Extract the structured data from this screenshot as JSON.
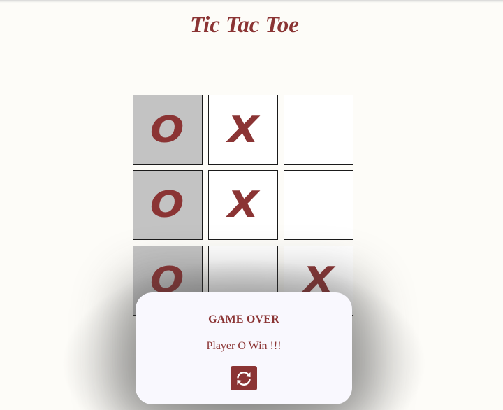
{
  "title": "Tic Tac Toe",
  "board": {
    "cells": [
      {
        "mark": "O",
        "winning": true
      },
      {
        "mark": "X",
        "winning": false
      },
      {
        "mark": "",
        "winning": false
      },
      {
        "mark": "O",
        "winning": true
      },
      {
        "mark": "X",
        "winning": false
      },
      {
        "mark": "",
        "winning": false
      },
      {
        "mark": "O",
        "winning": true
      },
      {
        "mark": "",
        "winning": false
      },
      {
        "mark": "X",
        "winning": false
      }
    ]
  },
  "modal": {
    "heading": "GAME OVER",
    "message": "Player O Win !!!",
    "restart_icon": "refresh-icon"
  },
  "colors": {
    "accent": "#8b3434",
    "background": "#fdfcf8",
    "winning_cell": "#c3c3c3",
    "modal_background": "#f9f8fe"
  }
}
